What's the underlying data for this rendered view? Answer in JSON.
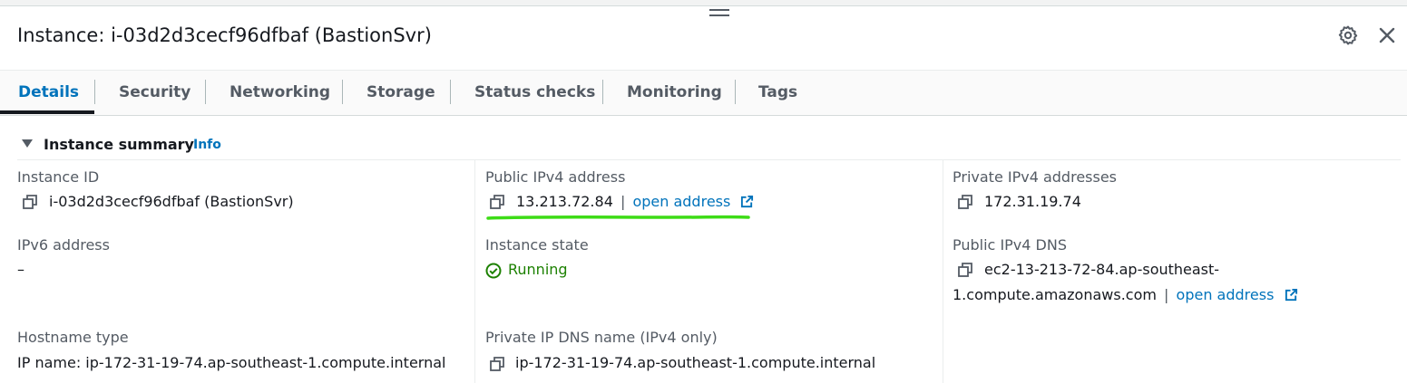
{
  "panel": {
    "title": "Instance: i-03d2d3cecf96dfbaf (BastionSvr)"
  },
  "tabs": [
    {
      "label": "Details",
      "active": true
    },
    {
      "label": "Security"
    },
    {
      "label": "Networking"
    },
    {
      "label": "Storage"
    },
    {
      "label": "Status checks"
    },
    {
      "label": "Monitoring"
    },
    {
      "label": "Tags"
    }
  ],
  "summary": {
    "header": "Instance summary",
    "info_link": "Info",
    "instance_id": {
      "label": "Instance ID",
      "value": "i-03d2d3cecf96dfbaf (BastionSvr)"
    },
    "public_ipv4": {
      "label": "Public IPv4 address",
      "value": "13.213.72.84",
      "separator": "|",
      "link": "open address"
    },
    "private_ipv4": {
      "label": "Private IPv4 addresses",
      "value": "172.31.19.74"
    },
    "ipv6": {
      "label": "IPv6 address",
      "value": "–"
    },
    "instance_state": {
      "label": "Instance state",
      "value": "Running"
    },
    "public_dns": {
      "label": "Public IPv4 DNS",
      "value_line1": "ec2-13-213-72-84.ap-southeast-",
      "value_line2": "1.compute.amazonaws.com",
      "separator": "|",
      "link": "open address"
    },
    "hostname_type": {
      "label": "Hostname type",
      "value": "IP name: ip-172-31-19-74.ap-southeast-1.compute.internal"
    },
    "private_dns": {
      "label": "Private IP DNS name (IPv4 only)",
      "value": "ip-172-31-19-74.ap-southeast-1.compute.internal"
    }
  },
  "colors": {
    "link": "#0073bb",
    "running": "#1d8102",
    "annotation": "#3ddc16"
  },
  "icons": [
    "drag-handle-icon",
    "gear-icon",
    "close-icon",
    "caret-down-icon",
    "copy-icon",
    "external-link-icon",
    "status-success-icon"
  ]
}
